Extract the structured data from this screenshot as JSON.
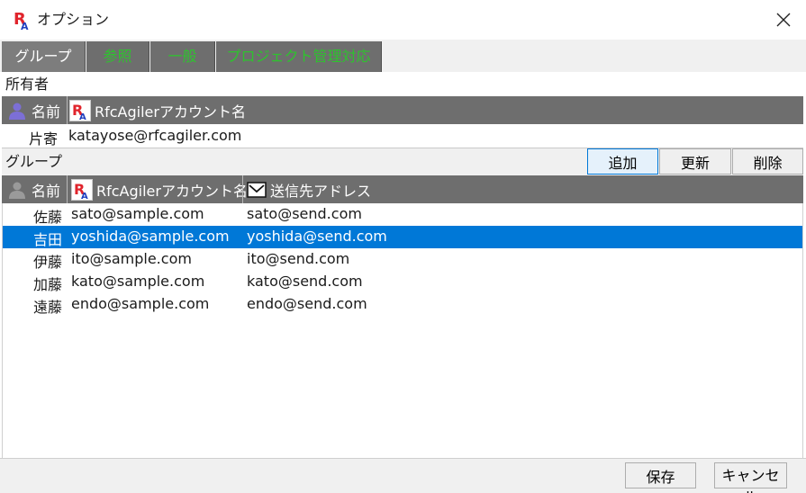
{
  "window": {
    "title": "オプション",
    "logo_text": "RA"
  },
  "tabs": [
    {
      "label": "グループ",
      "active": true
    },
    {
      "label": "参照",
      "active": false
    },
    {
      "label": "一般",
      "active": false
    },
    {
      "label": "プロジェクト管理対応",
      "active": false
    }
  ],
  "owner": {
    "section_label": "所有者",
    "columns": {
      "name": "名前",
      "account": "RfcAgilerアカウント名"
    },
    "row": {
      "name": "片寄",
      "account": "katayose@rfcagiler.com"
    }
  },
  "group": {
    "section_label": "グループ",
    "buttons": {
      "add": "追加",
      "update": "更新",
      "delete": "削除"
    },
    "columns": {
      "name": "名前",
      "account": "RfcAgilerアカウント名",
      "send": "送信先アドレス"
    },
    "rows": [
      {
        "name": "佐藤",
        "account": "sato@sample.com",
        "send": "sato@send.com",
        "selected": false
      },
      {
        "name": "吉田",
        "account": "yoshida@sample.com",
        "send": "yoshida@send.com",
        "selected": true
      },
      {
        "name": "伊藤",
        "account": "ito@sample.com",
        "send": "ito@send.com",
        "selected": false
      },
      {
        "name": "加藤",
        "account": "kato@sample.com",
        "send": "kato@send.com",
        "selected": false
      },
      {
        "name": "遠藤",
        "account": "endo@sample.com",
        "send": "endo@send.com",
        "selected": false
      }
    ]
  },
  "footer": {
    "save_label": "保存",
    "cancel_label": "キャンセル"
  },
  "colors": {
    "header_gray": "#6e6e6e",
    "tab_text_green": "#2ec32e",
    "selection_blue": "#0078d7",
    "logo_red": "#e0242c",
    "logo_blue": "#1f3fbf"
  }
}
